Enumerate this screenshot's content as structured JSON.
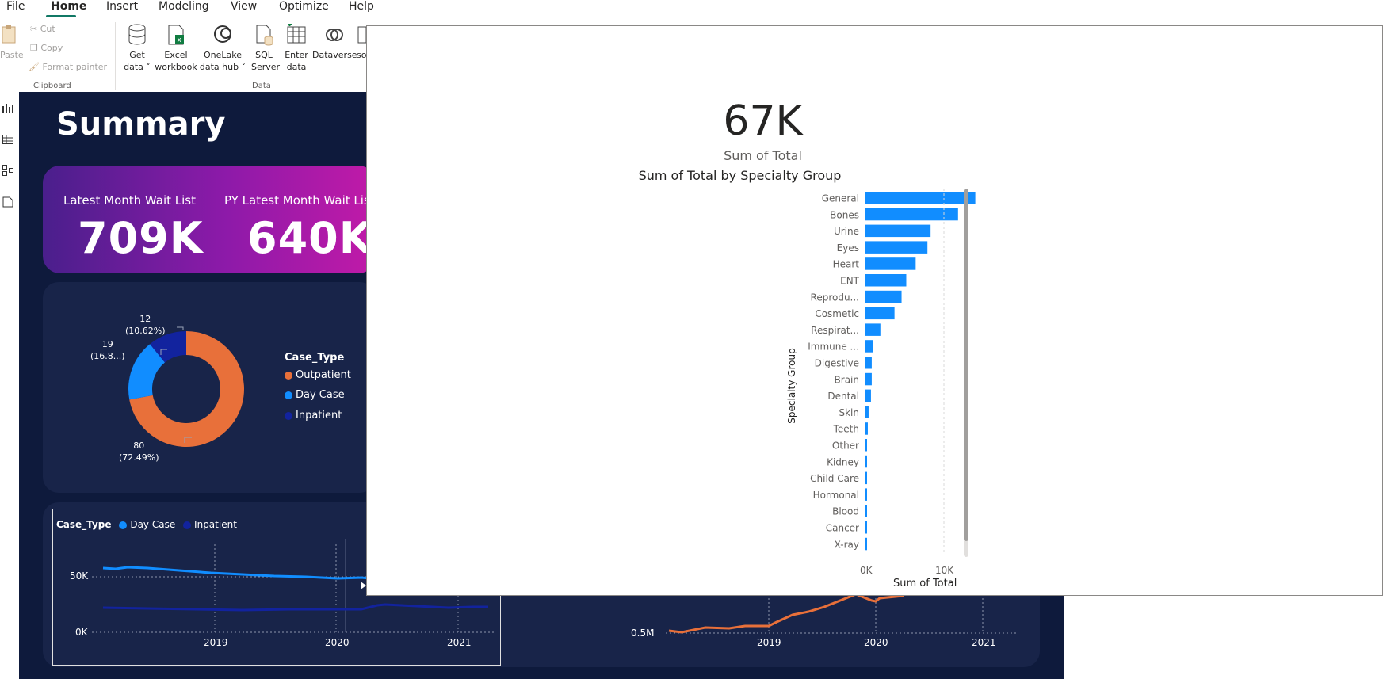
{
  "menu": [
    "File",
    "Home",
    "Insert",
    "Modeling",
    "View",
    "Optimize",
    "Help"
  ],
  "clipboard": {
    "paste": "Paste",
    "cut": "Cut",
    "copy": "Copy",
    "format_painter": "Format painter",
    "group": "Clipboard"
  },
  "data_group": {
    "get_data": [
      "Get",
      "data ˅"
    ],
    "excel": [
      "Excel",
      "workbook"
    ],
    "onelake": [
      "OneLake",
      "data hub ˅"
    ],
    "sql": [
      "SQL",
      "Server"
    ],
    "enter": [
      "Enter",
      "data"
    ],
    "dataverse": "Dataverse",
    "partial": [
      "",
      "so"
    ],
    "group": "Data"
  },
  "report": {
    "title": "Summary",
    "kpi1_label": "Latest Month Wait List",
    "kpi1_value": "709K",
    "kpi2_label": "PY Latest Month Wait List",
    "kpi2_value": "640K"
  },
  "donut": {
    "legend_title": "Case_Type",
    "legend": [
      {
        "label": "Outpatient",
        "color": "#e8703a"
      },
      {
        "label": "Day Case",
        "color": "#118dff"
      },
      {
        "label": "Inpatient",
        "color": "#12239e"
      }
    ],
    "slices": [
      {
        "label": "Outpatient",
        "value": 80,
        "pct": 72.49,
        "color": "#e8703a"
      },
      {
        "label": "Day Case",
        "value": 19,
        "pct": 16.8,
        "color": "#118dff"
      },
      {
        "label": "Inpatient",
        "value": 12,
        "pct": 10.62,
        "color": "#12239e"
      }
    ],
    "labels": {
      "inpatient": [
        "12",
        "(10.62%)"
      ],
      "daycase": [
        "19",
        "(16.8...)"
      ],
      "outpatient": [
        "80",
        "(72.49%)"
      ]
    }
  },
  "line_left": {
    "legend_title": "Case_Type",
    "legend": [
      {
        "label": "Day Case",
        "color": "#118dff"
      },
      {
        "label": "Inpatient",
        "color": "#12239e"
      }
    ],
    "y_ticks": [
      "50K",
      "0K"
    ],
    "x_ticks": [
      "2019",
      "2020",
      "2021"
    ]
  },
  "line_right": {
    "y_ticks": [
      "0.5M"
    ],
    "x_ticks": [
      "2019",
      "2020",
      "2021"
    ],
    "color": "#e8703a"
  },
  "popup": {
    "kpi_value": "67K",
    "kpi_label": "Sum of Total"
  },
  "chart_data": {
    "type": "bar",
    "orientation": "horizontal",
    "title": "Sum of Total by Specialty Group",
    "xlabel": "Sum of Total",
    "ylabel": "Specialty Group",
    "x_ticks": [
      "0K",
      "10K"
    ],
    "xlim": [
      0,
      16000
    ],
    "categories": [
      "General",
      "Bones",
      "Urine",
      "Eyes",
      "Heart",
      "ENT",
      "Reprodu...",
      "Cosmetic",
      "Respirat...",
      "Immune ...",
      "Digestive",
      "Brain",
      "Dental",
      "Skin",
      "Teeth",
      "Other",
      "Kidney",
      "Child Care",
      "Hormonal",
      "Blood",
      "Cancer",
      "X-ray"
    ],
    "values": [
      14000,
      11800,
      8300,
      7900,
      6400,
      5200,
      4600,
      3700,
      1900,
      1000,
      800,
      800,
      700,
      400,
      300,
      200,
      150,
      150,
      100,
      100,
      100,
      100
    ],
    "color": "#118dff"
  }
}
